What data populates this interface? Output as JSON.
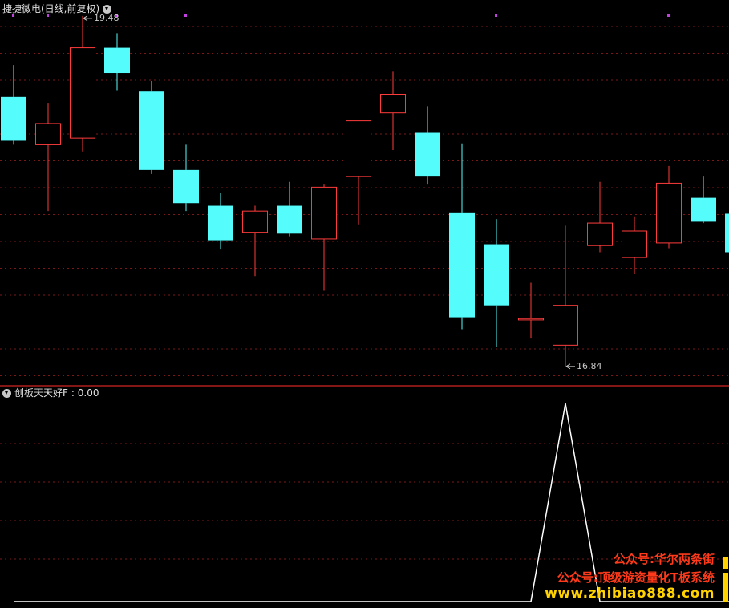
{
  "main_panel": {
    "title": "捷捷微电(日线,前复权)",
    "high_label": "19.48",
    "low_label": "16.84"
  },
  "indicator_panel": {
    "title": "创板天天好F",
    "value_text": ": 0.00"
  },
  "watermark": {
    "line1": "公众号:华尔两条街",
    "line2": "公众号:顶级游资量化T板系统",
    "line3": "www.zhibiao888.com"
  },
  "colors": {
    "up": "#ff3c3c",
    "down": "#54fcfc",
    "grid": "#7a1818",
    "divider": "#b01e1e",
    "indicator_line": "#ffffff",
    "signal_marker": "#c040e0",
    "watermark_red": "#ff3a1a",
    "watermark_yellow": "#ffd200"
  },
  "chart_data": [
    {
      "type": "candlestick",
      "title": "捷捷微电(日线,前复权)",
      "price_range": [
        16.7,
        19.6
      ],
      "annotations": [
        {
          "text": "19.48",
          "at_bar": 2,
          "kind": "high"
        },
        {
          "text": "16.84",
          "at_bar": 16,
          "kind": "low"
        }
      ],
      "signal_markers_at_bars": [
        0,
        1,
        3,
        5,
        14,
        19
      ],
      "candles": [
        {
          "open": 18.87,
          "high": 19.11,
          "low": 18.51,
          "close": 18.54
        },
        {
          "open": 18.51,
          "high": 18.82,
          "low": 18.01,
          "close": 18.67
        },
        {
          "open": 18.56,
          "high": 19.48,
          "low": 18.46,
          "close": 19.24
        },
        {
          "open": 19.24,
          "high": 19.35,
          "low": 18.92,
          "close": 19.05
        },
        {
          "open": 18.91,
          "high": 18.99,
          "low": 18.29,
          "close": 18.32
        },
        {
          "open": 18.32,
          "high": 18.51,
          "low": 18.01,
          "close": 18.07
        },
        {
          "open": 18.05,
          "high": 18.15,
          "low": 17.72,
          "close": 17.79
        },
        {
          "open": 17.85,
          "high": 18.05,
          "low": 17.52,
          "close": 18.01
        },
        {
          "open": 18.05,
          "high": 18.23,
          "low": 17.82,
          "close": 17.84
        },
        {
          "open": 17.8,
          "high": 18.21,
          "low": 17.41,
          "close": 18.19
        },
        {
          "open": 18.27,
          "high": 18.69,
          "low": 17.91,
          "close": 18.69
        },
        {
          "open": 18.75,
          "high": 19.06,
          "low": 18.47,
          "close": 18.89
        },
        {
          "open": 18.6,
          "high": 18.8,
          "low": 18.21,
          "close": 18.27
        },
        {
          "open": 18.0,
          "high": 18.52,
          "low": 17.12,
          "close": 17.21
        },
        {
          "open": 17.76,
          "high": 17.95,
          "low": 16.99,
          "close": 17.3
        },
        {
          "open": 17.19,
          "high": 17.47,
          "low": 17.05,
          "close": 17.2
        },
        {
          "open": 17.0,
          "high": 17.9,
          "low": 16.84,
          "close": 17.3
        },
        {
          "open": 17.75,
          "high": 18.23,
          "low": 17.7,
          "close": 17.92
        },
        {
          "open": 17.66,
          "high": 17.97,
          "low": 17.54,
          "close": 17.86
        },
        {
          "open": 17.77,
          "high": 18.35,
          "low": 17.73,
          "close": 18.22
        },
        {
          "open": 18.11,
          "high": 18.27,
          "low": 17.92,
          "close": 17.93
        },
        {
          "open": 17.99,
          "high": 18.1,
          "low": 17.69,
          "close": 17.7
        }
      ]
    },
    {
      "type": "line",
      "title": "创板天天好F",
      "series": [
        {
          "values": [
            0,
            0,
            0,
            0,
            0,
            0,
            0,
            0,
            0,
            0,
            0,
            0,
            0,
            0,
            0,
            0,
            1,
            0,
            0,
            0,
            0,
            0
          ]
        }
      ],
      "ylim": [
        0,
        1
      ]
    }
  ]
}
